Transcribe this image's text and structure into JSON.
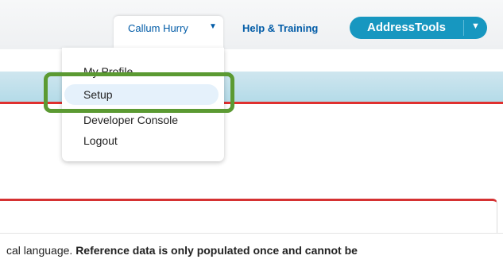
{
  "header": {
    "user_name": "Callum Hurry",
    "help_link": "Help & Training",
    "app_name": "AddressTools"
  },
  "user_menu": {
    "items": [
      {
        "label": "My Profile"
      },
      {
        "label": "Setup"
      },
      {
        "label": "Developer Console"
      },
      {
        "label": "Logout"
      }
    ],
    "highlighted": "Setup"
  },
  "body": {
    "text_prefix": "cal language. ",
    "text_bold": "Reference data is only populated once and cannot be"
  },
  "colors": {
    "accent_blue": "#1797c0",
    "link_blue": "#015ba7",
    "header_redline": "#e0302f",
    "highlight_green": "#5b9a32"
  },
  "icons": {
    "user_caret": "caret-down-icon",
    "app_caret": "caret-down-icon"
  }
}
